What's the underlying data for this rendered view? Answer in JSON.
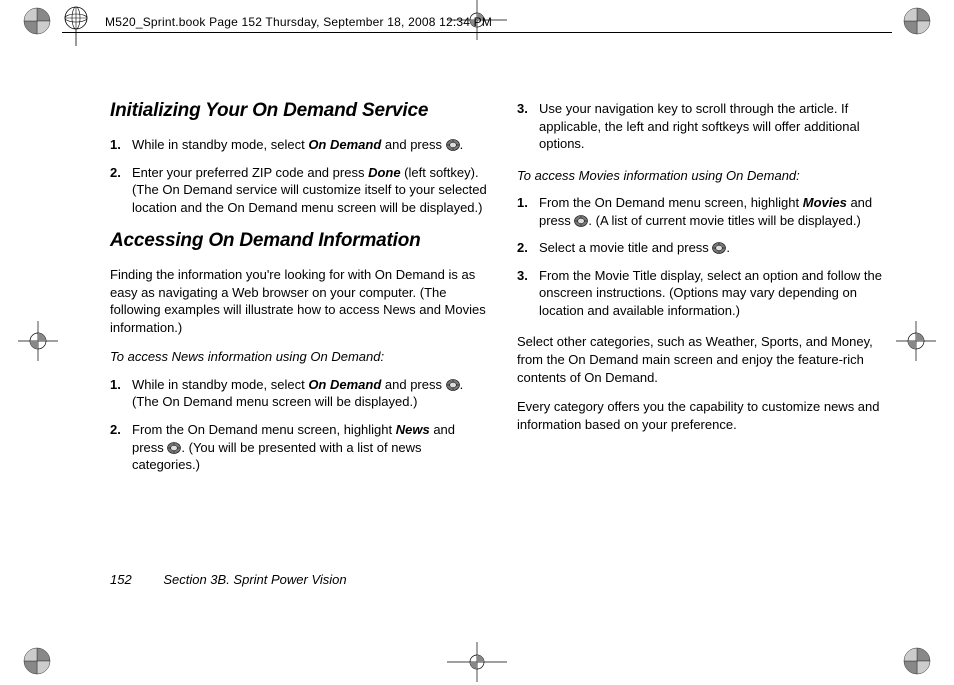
{
  "header": {
    "running_head": "M520_Sprint.book  Page 152  Thursday, September 18, 2008  12:34 PM"
  },
  "left": {
    "h1": "Initializing Your On Demand Service",
    "s1": {
      "n1": "1.",
      "t1a": "While in standby mode, select ",
      "t1b": "On Demand",
      "t1c": " and press ",
      "t1d": "."
    },
    "s2": {
      "n": "2.",
      "t1": "Enter your preferred ZIP code and press ",
      "done": "Done",
      "t2": " (left softkey). (The On Demand service will customize itself to your selected location and the On Demand menu screen will be displayed.)"
    },
    "h2": "Accessing On Demand Information",
    "p1": "Finding the information you're looking for with On Demand is as easy as navigating a Web browser on your computer. (The following examples will illustrate how to access News and Movies information.)",
    "sub1": "To access News information using On Demand:",
    "news": {
      "n1": "1.",
      "t1a": "While in standby mode, select ",
      "t1b": "On Demand",
      "t1c": " and press ",
      "t1d": ". (The On Demand menu screen will be displayed.)",
      "n2": "2.",
      "t2a": "From the On Demand menu screen, highlight ",
      "t2b": "News",
      "t2c": " and press ",
      "t2d": ". (You will be presented with a list of news categories.)"
    }
  },
  "right": {
    "s3": {
      "n": "3.",
      "t": "Use your navigation key to scroll through the article. If applicable, the left and right softkeys will offer additional options."
    },
    "sub2": "To access Movies information using On Demand:",
    "mov": {
      "n1": "1.",
      "t1a": "From the On Demand menu screen, highlight ",
      "t1b": "Movies",
      "t1c": " and press ",
      "t1d": ". (A list of current movie titles will be displayed.)",
      "n2": "2.",
      "t2a": "Select a movie title and press ",
      "t2b": ".",
      "n3": "3.",
      "t3": "From the Movie Title display, select an option and follow the onscreen instructions. (Options may vary depending on location and available information.)"
    },
    "p2": "Select other categories, such as Weather, Sports, and Money, from the On Demand main screen and enjoy the feature-rich contents of On Demand.",
    "p3": "Every category offers you the capability to customize news and information based on your preference."
  },
  "footer": {
    "page": "152",
    "section": "Section 3B. Sprint Power Vision"
  }
}
